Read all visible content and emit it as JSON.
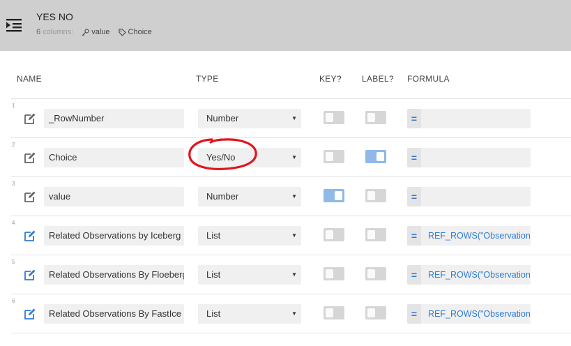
{
  "header": {
    "title": "YES NO",
    "columns_count": "6",
    "columns_word": "columns:",
    "key_column": "value",
    "label_column": "Choice"
  },
  "column_headers": {
    "name": "NAME",
    "type": "TYPE",
    "key": "KEY?",
    "label": "LABEL?",
    "formula": "FORMULA"
  },
  "rows": [
    {
      "num": "1",
      "name": "_RowNumber",
      "type": "Number",
      "key": false,
      "label": false,
      "formula": "",
      "edit_color": "#666666"
    },
    {
      "num": "2",
      "name": "Choice",
      "type": "Yes/No",
      "key": false,
      "label": true,
      "formula": "",
      "edit_color": "#666666"
    },
    {
      "num": "3",
      "name": "value",
      "type": "Number",
      "key": true,
      "label": false,
      "formula": "",
      "edit_color": "#666666"
    },
    {
      "num": "4",
      "name": "Related Observations by Iceberg",
      "type": "List",
      "key": false,
      "label": false,
      "formula": "REF_ROWS(\"Observation",
      "edit_color": "#2e7bd6"
    },
    {
      "num": "5",
      "name": "Related Observations By Floeberg",
      "type": "List",
      "key": false,
      "label": false,
      "formula": "REF_ROWS(\"Observation",
      "edit_color": "#2e7bd6"
    },
    {
      "num": "6",
      "name": "Related Observations By FastIce",
      "type": "List",
      "key": false,
      "label": false,
      "formula": "REF_ROWS(\"Observation",
      "edit_color": "#2e7bd6"
    }
  ],
  "formula_symbol": "=",
  "colors": {
    "header_bg": "#cfcfcf",
    "toggle_on": "#8fb9e6",
    "accent_blue": "#2e7bd6",
    "annotation_red": "#e0141e"
  }
}
